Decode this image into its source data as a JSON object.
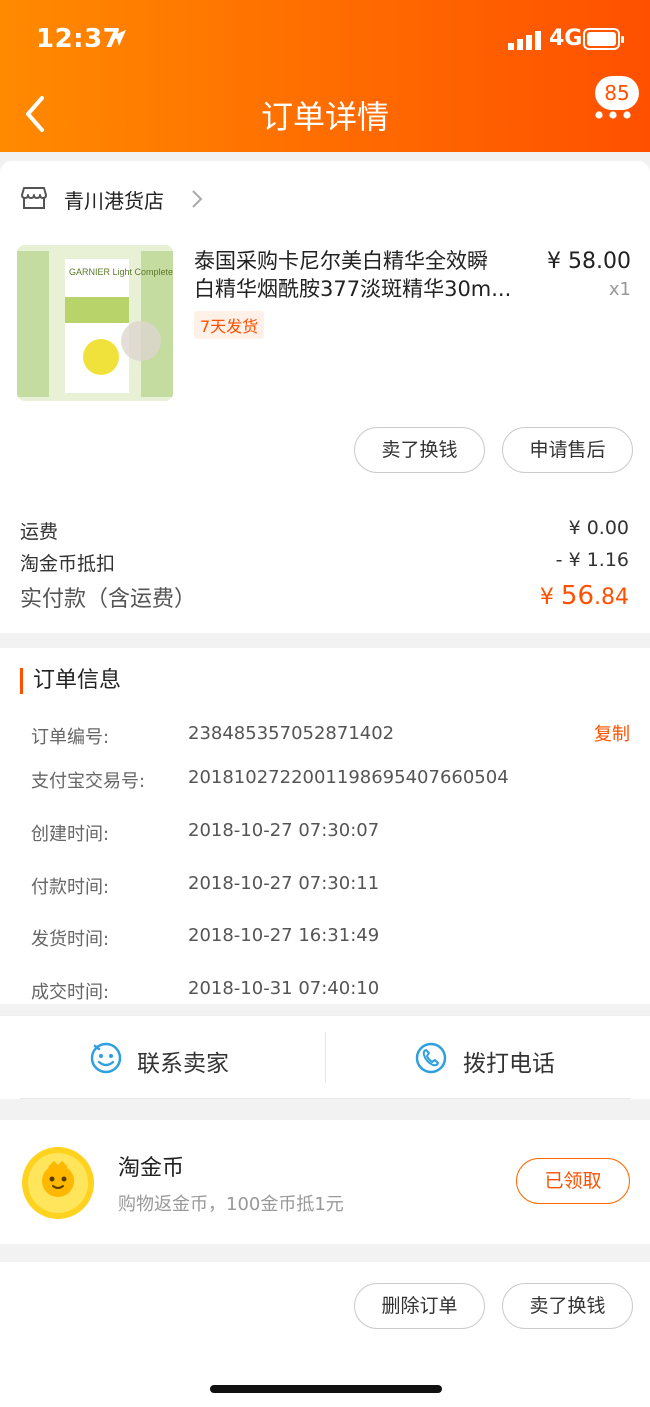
{
  "status_bar": {
    "time": "12:37",
    "network": "4G"
  },
  "nav": {
    "title": "订单详情",
    "badge_count": "85"
  },
  "shop": {
    "name": "青川港货店"
  },
  "product": {
    "title_line1": "泰国采购卡尼尔美白精华全效瞬",
    "title_line2": "白精华烟酰胺377淡斑精华30m...",
    "shipping_tag": "7天发货",
    "price": "¥ 58.00",
    "quantity": "x1",
    "image_label": "GARNIER Light Complete"
  },
  "item_actions": {
    "sell_label": "卖了换钱",
    "after_sale_label": "申请售后"
  },
  "fees": {
    "shipping_label": "运费",
    "shipping_value": "¥ 0.00",
    "coin_label": "淘金币抵扣",
    "coin_value": "- ¥ 1.16",
    "total_label": "实付款（含运费）",
    "total_currency": "¥",
    "total_integer": "56",
    "total_decimal": ".84"
  },
  "order_info": {
    "section_title": "订单信息",
    "copy_label": "复制",
    "rows": [
      {
        "label": "订单编号:",
        "value": "238485357052871402"
      },
      {
        "label": "支付宝交易号:",
        "value": "2018102722001198695407660504"
      },
      {
        "label": "创建时间:",
        "value": "2018-10-27 07:30:07"
      },
      {
        "label": "付款时间:",
        "value": "2018-10-27 07:30:11"
      },
      {
        "label": "发货时间:",
        "value": "2018-10-27 16:31:49"
      },
      {
        "label": "成交时间:",
        "value": "2018-10-31 07:40:10"
      }
    ]
  },
  "contact": {
    "seller_label": "联系卖家",
    "call_label": "拨打电话"
  },
  "coin_promo": {
    "title": "淘金币",
    "desc": "购物返金币，100金币抵1元",
    "button_label": "已领取"
  },
  "bottom_actions": {
    "delete_label": "删除订单",
    "sell_label": "卖了换钱"
  },
  "colors": {
    "brand": "#ff5000",
    "header_start": "#ff8a00",
    "header_end": "#ff5000"
  }
}
